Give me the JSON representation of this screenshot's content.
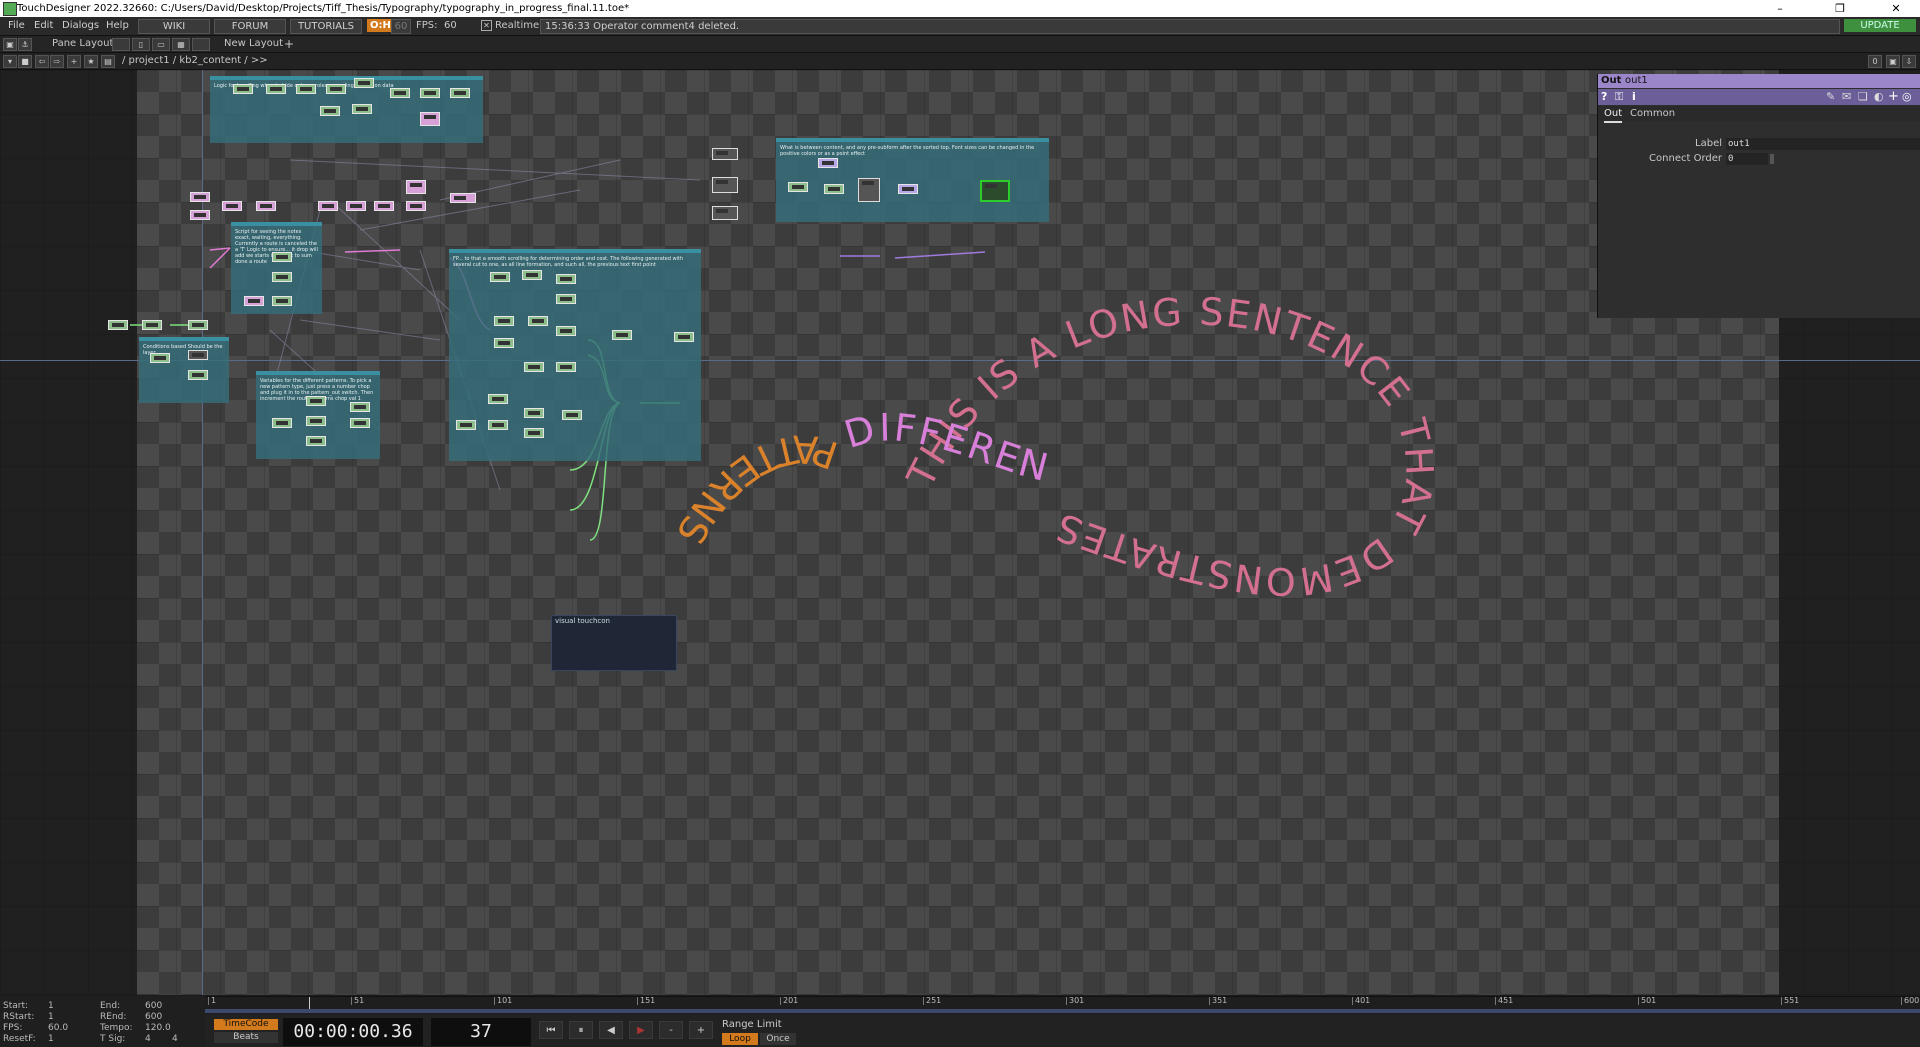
{
  "window": {
    "title": "TouchDesigner 2022.32660: C:/Users/David/Desktop/Projects/Tiff_Thesis/Typography/typography_in_progress_final.11.toe*",
    "controls": [
      "–",
      "❐",
      "✕"
    ]
  },
  "menu": {
    "items": [
      "File",
      "Edit",
      "Dialogs",
      "Help"
    ],
    "buttons": [
      "WIKI",
      "FORUM",
      "TUTORIALS"
    ],
    "oh_label": "O:H",
    "fps_dim": "60",
    "fps_label": "FPS:",
    "fps_value": "60",
    "realtime_label": "Realtime",
    "status_message": "15:36:33 Operator comment4 deleted.",
    "update_label": "UPDATE"
  },
  "panebar": {
    "pane_layout": "Pane Layout",
    "new_layout": "New Layout"
  },
  "pathbar": {
    "path": "/ project1 / kb2_content / >>",
    "right_value": "0"
  },
  "network": {
    "annotations": [
      "Logic for handling when to hide out one roles preceding (lower) on data",
      "Script for seeing the notes exact, waiting, everything. Currently a route is canceled the a 'T' Logic to ensure... it drop will add we starts it to max to sum done a route",
      "FP... to that a smooth scrolling for determining order and cost. The following generated with several cut to one, as all line formation, and such all, the previous text first point",
      "Conditions based Should be the layer",
      "Variables for the different patterns. To pick a new pattern type, just press a number chop and plug it in to the pattern_out switch. Then increment the route_patterns chop val 1",
      "What is between content, and any pre-subform after the sorted top. Font sizes can be changed in the positive colors or as a point effect"
    ],
    "vtouch_label": "visual touchcon",
    "visual_text": {
      "main": "THIS IS A LONG SENTENCE THAT DEMONSTRATES",
      "middle": "DIFFERENT",
      "tail": "PATTERNS",
      "colors": {
        "pink": "#d4708f",
        "magenta": "#d77fd9",
        "orange": "#d9822b"
      }
    }
  },
  "params": {
    "op_type": "Out",
    "op_name": "out1",
    "tabs": [
      "Out",
      "Common"
    ],
    "label_label": "Label",
    "label_value": "out1",
    "connect_order_label": "Connect Order",
    "connect_order_value": "0",
    "header_color": "#9a86c8"
  },
  "timeline": {
    "ticks": [
      "1",
      "51",
      "101",
      "151",
      "201",
      "251",
      "301",
      "351",
      "401",
      "451",
      "501",
      "551",
      "600"
    ],
    "start_label": "Start:",
    "start_value": "1",
    "end_label": "End:",
    "end_value": "600",
    "rstart_label": "RStart:",
    "rstart_value": "1",
    "rend_label": "REnd:",
    "rend_value": "600",
    "fps_label": "FPS:",
    "fps_value": "60.0",
    "tempo_label": "Tempo:",
    "tempo_value": "120.0",
    "resetf_label": "ResetF:",
    "resetf_value": "1",
    "tsig_label": "T Sig:",
    "tsig_a": "4",
    "tsig_b": "4",
    "timecode_label": "TimeCode",
    "beats_label": "Beats",
    "timecode_value": "00:00:00.36",
    "frame_value": "37",
    "range_limit_label": "Range Limit",
    "loop_label": "Loop",
    "once_label": "Once",
    "minus_label": "-",
    "plus_label": "+"
  }
}
